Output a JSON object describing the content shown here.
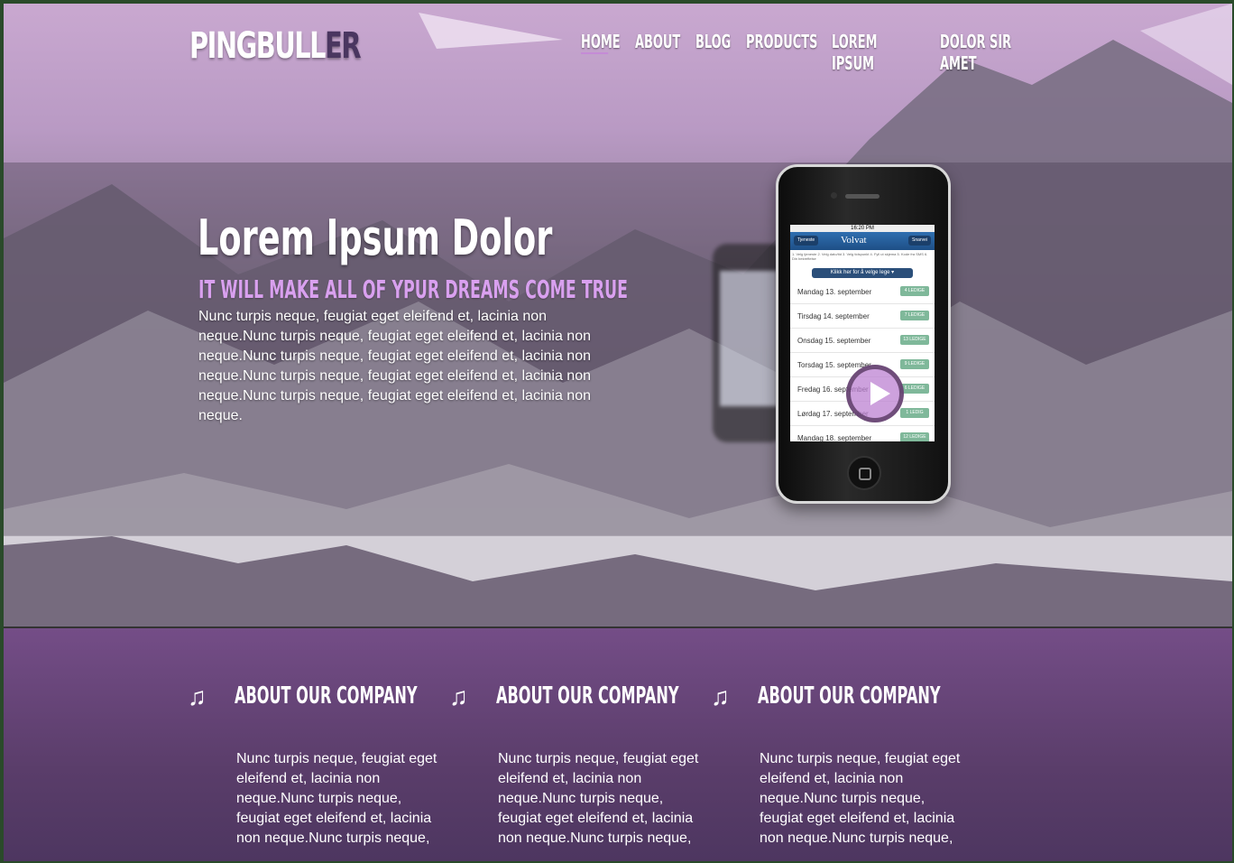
{
  "site": {
    "logo_main": "PINGBULL",
    "logo_accent": "ER"
  },
  "nav": [
    {
      "label": "HOME",
      "active": true
    },
    {
      "label": "ABOUT"
    },
    {
      "label": "BLOG"
    },
    {
      "label": "PRODUCTS"
    },
    {
      "label": "LOREM IPSUM"
    },
    {
      "label": "DOLOR SIR AMET"
    }
  ],
  "hero": {
    "title": "Lorem Ipsum Dolor",
    "subtitle": "IT WILL MAKE ALL OF YPUR DREAMS COME TRUE",
    "text": "Nunc turpis neque, feugiat eget eleifend et, lacinia non neque.Nunc turpis neque, feugiat eget eleifend et, lacinia non neque.Nunc turpis neque, feugiat eget eleifend et, lacinia non neque.Nunc turpis neque, feugiat eget eleifend et, lacinia non neque.Nunc turpis neque, feugiat eget eleifend et, lacinia non neque."
  },
  "phone": {
    "time": "16:20 PM",
    "back_button": "Tjeneste",
    "brand": "Volvat",
    "right_button": "Snarvei",
    "steps": "1. Velg tjeneste   2. Velg dato/tid   3. Velg tidspunkt   4. Fyll ut skjema   5. Kode fra SMS   6. Din bekreftelse",
    "pick_button": "Klikk her for å velge lege ▾",
    "rows": [
      {
        "day": "Mandag 13. september",
        "badge": "4 LEDIGE"
      },
      {
        "day": "Tirsdag 14. september",
        "badge": "7 LEDIGE"
      },
      {
        "day": "Onsdag 15. september",
        "badge": "13 LEDIGE"
      },
      {
        "day": "Torsdag 15. september",
        "badge": "9 LEDIGE"
      },
      {
        "day": "Fredag 16. september",
        "badge": "6 LEDIGE"
      },
      {
        "day": "Lørdag 17. september",
        "badge": "1 LEDIG"
      },
      {
        "day": "Mandag 18. september",
        "badge": "12 LEDIGE"
      }
    ]
  },
  "features": [
    {
      "icon": "music-note-icon",
      "title": "ABOUT OUR COMPANY",
      "text": "Nunc turpis neque, feugiat eget eleifend et, lacinia non neque.Nunc turpis neque, feugiat eget eleifend et, lacinia non neque.Nunc turpis neque,"
    },
    {
      "icon": "music-note-icon",
      "title": "ABOUT OUR COMPANY",
      "text": "Nunc turpis neque, feugiat eget eleifend et, lacinia non neque.Nunc turpis neque, feugiat eget eleifend et, lacinia non neque.Nunc turpis neque,"
    },
    {
      "icon": "music-note-icon",
      "title": "ABOUT OUR COMPANY",
      "text": "Nunc turpis neque, feugiat eget eleifend et, lacinia non neque.Nunc turpis neque, feugiat eget eleifend et, lacinia non neque.Nunc turpis neque,"
    }
  ],
  "colors": {
    "accent": "#c58bd6",
    "subtitle": "#d9a0ef",
    "features_bg": "#6a4880"
  }
}
